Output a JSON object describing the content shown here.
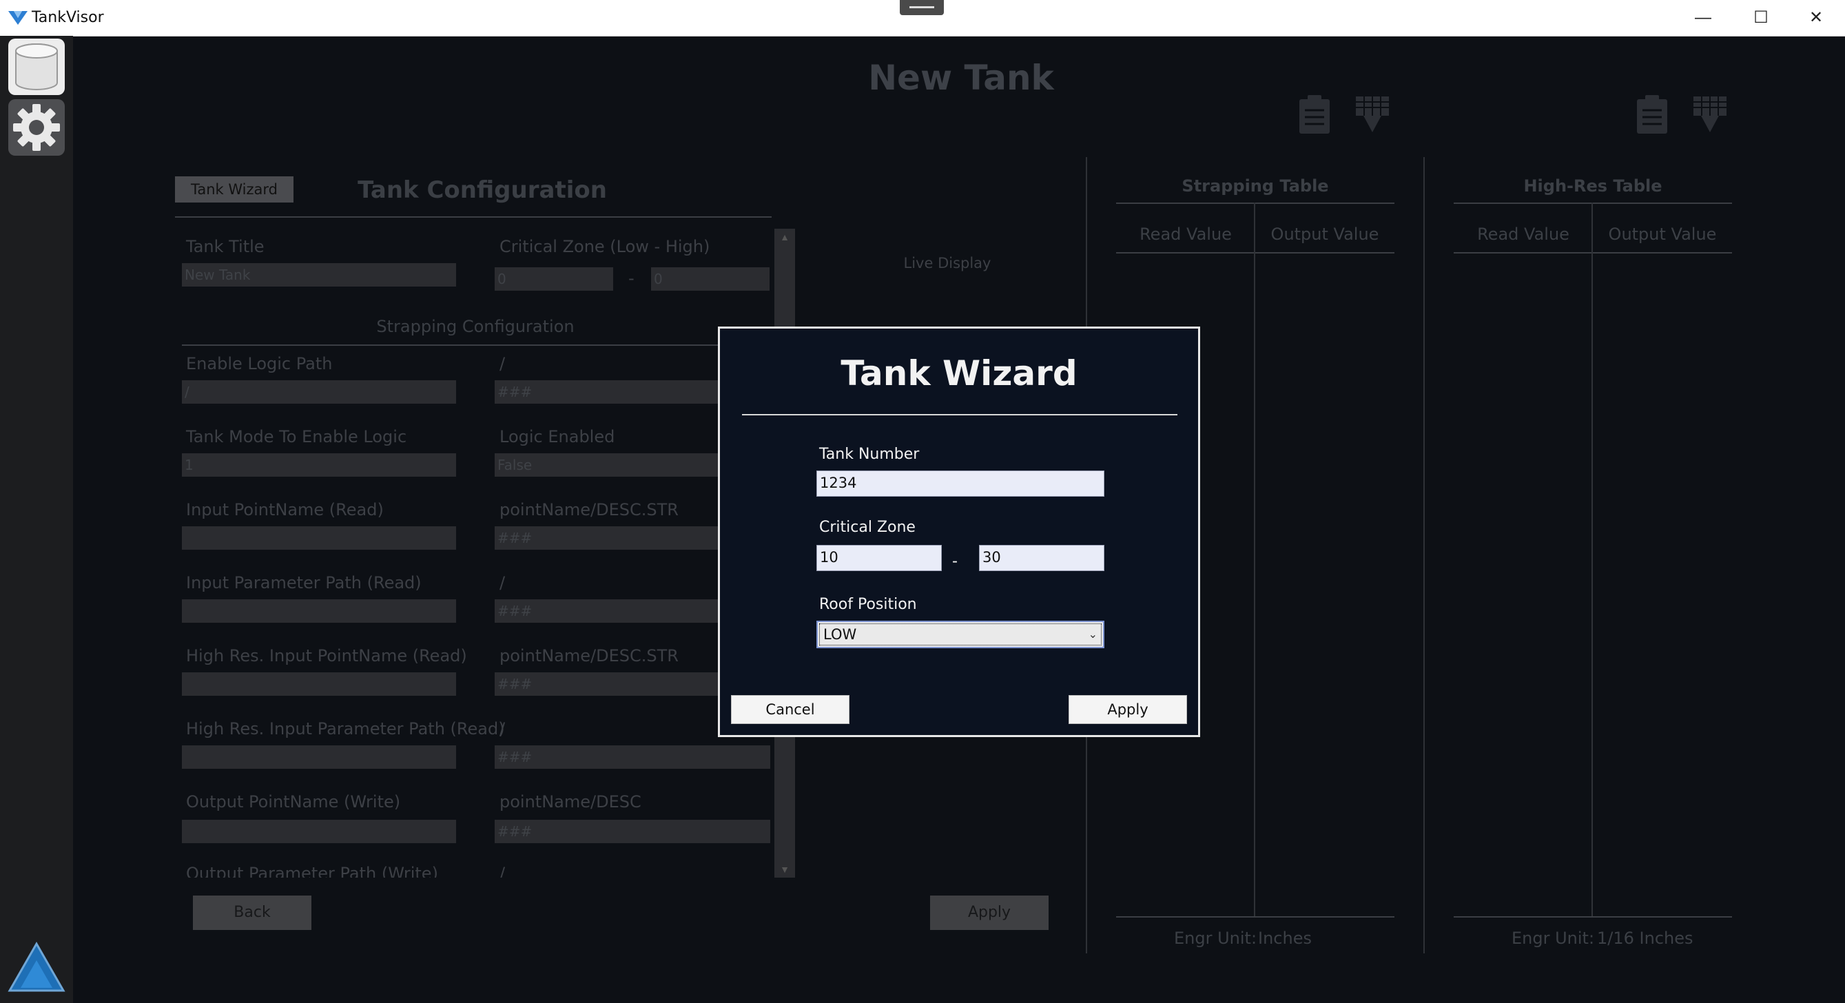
{
  "window": {
    "title": "TankVisor",
    "minimize_label": "—",
    "maximize_label": "☐",
    "close_label": "✕"
  },
  "sidebar": {
    "items": [
      {
        "name": "database",
        "icon": "database-icon"
      },
      {
        "name": "settings",
        "icon": "gear-icon"
      }
    ]
  },
  "header": {
    "title": "New Tank"
  },
  "config": {
    "wizard_button": "Tank Wizard",
    "title": "Tank Configuration",
    "tank_title_label": "Tank Title",
    "tank_title_value": "New Tank",
    "critical_zone_label": "Critical Zone (Low - High)",
    "critical_low": "0",
    "critical_dash": "-",
    "critical_high": "0",
    "strapping_section": "Strapping Configuration",
    "rows": [
      {
        "left_label": "Enable Logic Path",
        "left_value": "/",
        "right_label": "/",
        "right_value": "###"
      },
      {
        "left_label": "Tank Mode To Enable Logic",
        "left_value": "1",
        "right_label": "Logic Enabled",
        "right_value": "False"
      },
      {
        "left_label": "Input PointName (Read)",
        "left_value": "",
        "right_label": "pointName/DESC.STR",
        "right_value": "###"
      },
      {
        "left_label": "Input Parameter Path (Read)",
        "left_value": "",
        "right_label": "/",
        "right_value": "###"
      },
      {
        "left_label": "High Res. Input PointName (Read)",
        "left_value": "",
        "right_label": "pointName/DESC.STR",
        "right_value": "###"
      },
      {
        "left_label": "High Res. Input Parameter Path (Read)",
        "left_value": "",
        "right_label": "/",
        "right_value": "###"
      },
      {
        "left_label": "Output PointName (Write)",
        "left_value": "",
        "right_label": "pointName/DESC",
        "right_value": "###"
      },
      {
        "left_label": "Output Parameter Path (Write)",
        "left_value": "",
        "right_label": "/",
        "right_value": ""
      }
    ],
    "back_button": "Back",
    "apply_button": "Apply"
  },
  "live_display": "Live Display",
  "strapping_table": {
    "title": "Strapping Table",
    "col_read": "Read Value",
    "col_output": "Output Value",
    "engr_label": "Engr Unit:",
    "engr_value": "Inches"
  },
  "highres_table": {
    "title": "High-Res Table",
    "col_read": "Read Value",
    "col_output": "Output Value",
    "engr_label": "Engr Unit:",
    "engr_value": "1/16 Inches"
  },
  "wizard": {
    "title": "Tank Wizard",
    "tank_number_label": "Tank Number",
    "tank_number_value": "1234",
    "critical_zone_label": "Critical Zone",
    "critical_low": "10",
    "dash": "-",
    "critical_high": "30",
    "roof_position_label": "Roof Position",
    "roof_position_value": "LOW",
    "cancel_button": "Cancel",
    "apply_button": "Apply"
  }
}
